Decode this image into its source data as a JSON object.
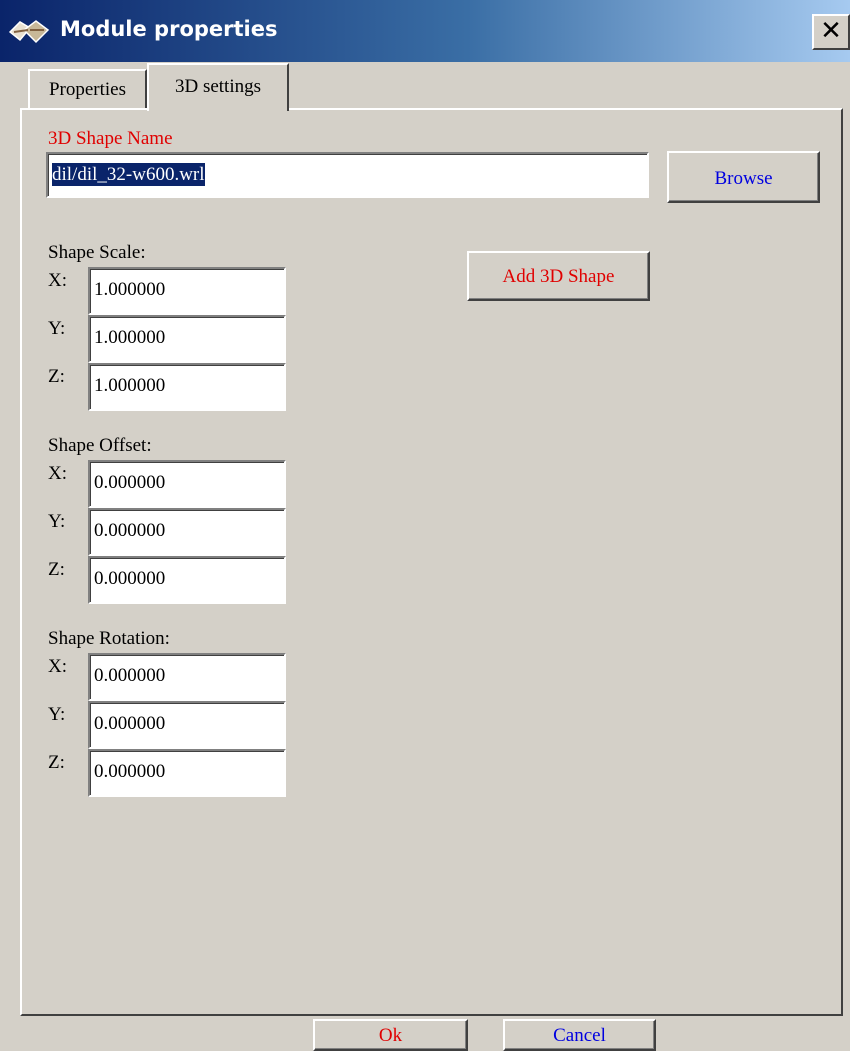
{
  "window": {
    "title": "Module properties",
    "app_icon": "module-3d-icon",
    "close_glyph": "✕"
  },
  "tabs": [
    {
      "label": "Properties",
      "active": false
    },
    {
      "label": "3D settings",
      "active": true
    }
  ],
  "shape_name": {
    "label": "3D Shape Name",
    "value": "dil/dil_32-w600.wrl",
    "browse_label": "Browse"
  },
  "add_shape_label": "Add 3D Shape",
  "scale": {
    "label": "Shape Scale:",
    "x_label": "X:",
    "x": "1.000000",
    "y_label": "Y:",
    "y": "1.000000",
    "z_label": "Z:",
    "z": "1.000000"
  },
  "offset": {
    "label": "Shape Offset:",
    "x_label": "X:",
    "x": "0.000000",
    "y_label": "Y:",
    "y": "0.000000",
    "z_label": "Z:",
    "z": "0.000000"
  },
  "rotation": {
    "label": "Shape Rotation:",
    "x_label": "X:",
    "x": "0.000000",
    "y_label": "Y:",
    "y": "0.000000",
    "z_label": "Z:",
    "z": "0.000000"
  },
  "buttons": {
    "ok": "Ok",
    "cancel": "Cancel"
  },
  "colors": {
    "title_start": "#0a246a",
    "title_end": "#a6caf0",
    "face": "#d4d0c8",
    "red_text": "#e00000",
    "blue_text": "#0000e0",
    "selection": "#0a246a"
  }
}
